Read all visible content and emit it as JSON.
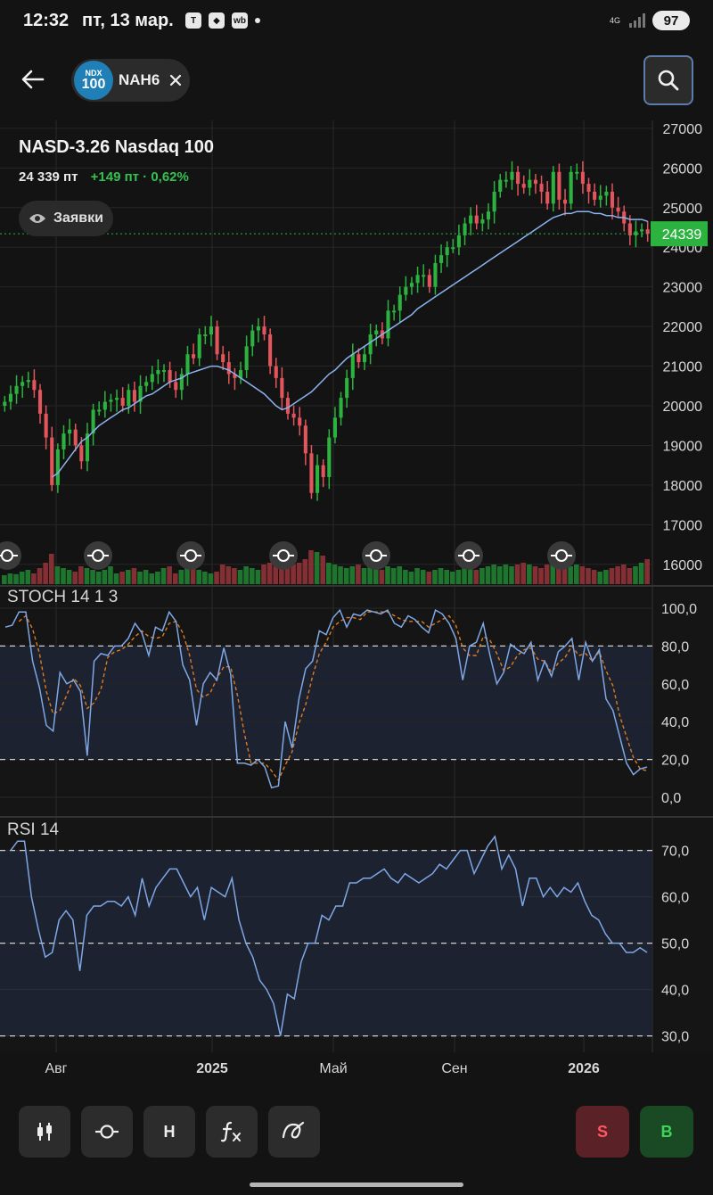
{
  "status_bar": {
    "time": "12:32",
    "date": "пт, 13 мар.",
    "network": "4G",
    "battery": "97",
    "icons": [
      "t-icon",
      "shield-icon",
      "wb-icon",
      "dot-icon"
    ]
  },
  "header": {
    "chip_logo_top": "NDX",
    "chip_logo_bottom": "100",
    "chip_label": "NAH6"
  },
  "instrument": {
    "title": "NASD-3.26 Nasdaq 100",
    "price": "24 339 пт",
    "change": "+149 пт · 0,62%",
    "orders_button": "Заявки"
  },
  "chart_data": [
    {
      "type": "candlestick",
      "title": "",
      "x_labels": [
        "Авг",
        "2025",
        "Май",
        "Сен",
        "2026"
      ],
      "y_ticks": [
        "27000",
        "26000",
        "25000",
        "24000",
        "23000",
        "22000",
        "21000",
        "20000",
        "19000",
        "18000",
        "17000",
        "16000"
      ],
      "last_price_label": "24339",
      "last_price": 24339,
      "ylim": [
        15500,
        27200
      ],
      "colors": {
        "up": "#2cb33f",
        "down": "#e2555c",
        "ma": "#8ab4ee",
        "last_price": "#2cb33f"
      },
      "close": [
        20100,
        20300,
        20500,
        20600,
        20650,
        20400,
        19800,
        19200,
        18000,
        18900,
        19300,
        19400,
        19000,
        18600,
        19300,
        19900,
        19900,
        20100,
        20150,
        20200,
        20000,
        20400,
        20100,
        20500,
        20600,
        20800,
        20900,
        20900,
        20600,
        20400,
        20800,
        21300,
        21200,
        21800,
        21800,
        22000,
        21300,
        21100,
        20800,
        20700,
        20900,
        21500,
        21900,
        22000,
        21800,
        21000,
        20700,
        20200,
        19800,
        19700,
        19500,
        18800,
        17800,
        18500,
        18200,
        19200,
        19700,
        20200,
        20700,
        21300,
        21100,
        21300,
        21800,
        21900,
        21700,
        22400,
        22400,
        22800,
        23000,
        23100,
        23300,
        23300,
        23000,
        23600,
        23800,
        24000,
        24000,
        24300,
        24600,
        24800,
        24600,
        24700,
        24900,
        25400,
        25700,
        25700,
        25900,
        25600,
        25500,
        25700,
        25600,
        25400,
        25100,
        25900,
        25200,
        25100,
        25900,
        25900,
        25600,
        25400,
        25200,
        25300,
        25400,
        25000,
        24900,
        24600,
        24300,
        24400,
        24450,
        24339
      ],
      "ma": [
        null,
        null,
        null,
        null,
        null,
        null,
        null,
        null,
        18200,
        18300,
        18500,
        18700,
        18900,
        19100,
        19200,
        19350,
        19500,
        19600,
        19700,
        19800,
        19900,
        19950,
        20050,
        20150,
        20250,
        20300,
        20400,
        20500,
        20600,
        20650,
        20700,
        20800,
        20850,
        20900,
        20950,
        21000,
        21000,
        20950,
        20900,
        20800,
        20700,
        20600,
        20500,
        20400,
        20300,
        20150,
        20000,
        19900,
        19950,
        20050,
        20150,
        20250,
        20350,
        20500,
        20650,
        20800,
        20900,
        21050,
        21200,
        21300,
        21400,
        21500,
        21600,
        21700,
        21800,
        21900,
        22000,
        22100,
        22200,
        22300,
        22450,
        22550,
        22650,
        22750,
        22850,
        22950,
        23050,
        23150,
        23250,
        23350,
        23450,
        23550,
        23650,
        23750,
        23850,
        23950,
        24050,
        24150,
        24250,
        24350,
        24450,
        24550,
        24650,
        24750,
        24800,
        24850,
        24850,
        24900,
        24900,
        24900,
        24850,
        24850,
        24800,
        24800,
        24750,
        24750,
        24700,
        24700,
        24700,
        24650
      ],
      "volume": [
        0.25,
        0.3,
        0.28,
        0.35,
        0.4,
        0.3,
        0.45,
        0.6,
        0.85,
        0.5,
        0.45,
        0.4,
        0.35,
        0.5,
        0.45,
        0.4,
        0.35,
        0.4,
        0.5,
        0.3,
        0.35,
        0.4,
        0.45,
        0.35,
        0.4,
        0.3,
        0.35,
        0.45,
        0.5,
        0.3,
        0.4,
        0.45,
        0.5,
        0.4,
        0.35,
        0.3,
        0.35,
        0.55,
        0.5,
        0.45,
        0.4,
        0.5,
        0.45,
        0.4,
        0.55,
        0.6,
        0.5,
        0.45,
        0.5,
        0.55,
        0.6,
        0.7,
        0.95,
        0.9,
        0.8,
        0.6,
        0.55,
        0.5,
        0.45,
        0.5,
        0.55,
        0.45,
        0.5,
        0.45,
        0.4,
        0.5,
        0.45,
        0.5,
        0.4,
        0.35,
        0.45,
        0.4,
        0.35,
        0.4,
        0.45,
        0.4,
        0.35,
        0.4,
        0.45,
        0.5,
        0.4,
        0.45,
        0.5,
        0.55,
        0.5,
        0.55,
        0.5,
        0.55,
        0.6,
        0.55,
        0.5,
        0.45,
        0.55,
        0.6,
        0.5,
        0.45,
        0.5,
        0.55,
        0.5,
        0.45,
        0.4,
        0.35,
        0.4,
        0.45,
        0.5,
        0.55,
        0.45,
        0.5,
        0.6,
        0.7
      ]
    },
    {
      "type": "line",
      "name": "STOCH 14 1 3",
      "y_ticks": [
        "100,0",
        "80,0",
        "60,0",
        "40,0",
        "20,0",
        "0,0"
      ],
      "ylim": [
        0,
        100
      ],
      "levels": [
        80,
        20
      ],
      "colors": {
        "k": "#7fa7e5",
        "d": "#e07a1f"
      },
      "k": [
        90,
        91,
        98,
        98,
        72,
        58,
        38,
        35,
        66,
        60,
        62,
        56,
        22,
        72,
        76,
        75,
        80,
        80,
        84,
        92,
        87,
        75,
        90,
        88,
        98,
        93,
        70,
        62,
        38,
        60,
        66,
        62,
        79,
        65,
        18,
        18,
        17,
        20,
        16,
        5,
        6,
        40,
        26,
        52,
        68,
        72,
        88,
        86,
        95,
        99,
        90,
        97,
        96,
        99,
        98,
        97,
        99,
        92,
        90,
        96,
        94,
        90,
        87,
        99,
        97,
        92,
        84,
        62,
        80,
        82,
        92,
        75,
        60,
        66,
        81,
        78,
        76,
        82,
        62,
        72,
        64,
        77,
        80,
        84,
        62,
        82,
        72,
        78,
        52,
        46,
        32,
        18,
        12,
        15,
        16
      ],
      "d": [
        null,
        null,
        93,
        96,
        89,
        76,
        56,
        44,
        46,
        54,
        63,
        59,
        47,
        50,
        57,
        74,
        77,
        78,
        81,
        85,
        88,
        85,
        84,
        85,
        92,
        93,
        87,
        75,
        57,
        53,
        55,
        63,
        69,
        69,
        54,
        34,
        18,
        18,
        18,
        14,
        9,
        17,
        24,
        39,
        49,
        64,
        76,
        82,
        90,
        93,
        95,
        95,
        94,
        98,
        98,
        98,
        98,
        96,
        94,
        93,
        93,
        93,
        90,
        92,
        94,
        96,
        91,
        79,
        75,
        75,
        85,
        83,
        76,
        67,
        69,
        75,
        78,
        79,
        73,
        72,
        66,
        71,
        74,
        80,
        75,
        76,
        72,
        77,
        67,
        59,
        43,
        32,
        21,
        15,
        14
      ]
    },
    {
      "type": "line",
      "name": "RSI 14",
      "y_ticks": [
        "70,0",
        "60,0",
        "50,0",
        "40,0",
        "30,0"
      ],
      "ylim": [
        28,
        73
      ],
      "levels": [
        70,
        50,
        30
      ],
      "colors": {
        "rsi": "#7fa7e5"
      },
      "rsi": [
        70,
        72,
        72,
        60,
        53,
        47,
        48,
        55,
        57,
        55,
        44,
        56,
        58,
        58,
        59,
        59,
        58,
        60,
        56,
        64,
        58,
        62,
        64,
        66,
        66,
        63,
        60,
        62,
        55,
        62,
        61,
        60,
        64,
        55,
        50,
        47,
        42,
        40,
        37,
        30,
        39,
        38,
        46,
        50,
        50,
        56,
        55,
        58,
        58,
        63,
        63,
        64,
        64,
        65,
        66,
        64,
        63,
        65,
        64,
        63,
        64,
        65,
        67,
        66,
        68,
        70,
        70,
        65,
        68,
        71,
        73,
        66,
        69,
        66,
        58,
        64,
        64,
        60,
        62,
        60,
        62,
        61,
        63,
        59,
        56,
        55,
        52,
        50,
        50,
        48,
        48,
        49,
        48
      ]
    }
  ],
  "toolbar": {
    "tools": [
      "candles-icon",
      "indicator-icon",
      "H",
      "fx-icon",
      "drawing-icon"
    ],
    "h_label": "H",
    "sell_label": "S",
    "buy_label": "B"
  }
}
